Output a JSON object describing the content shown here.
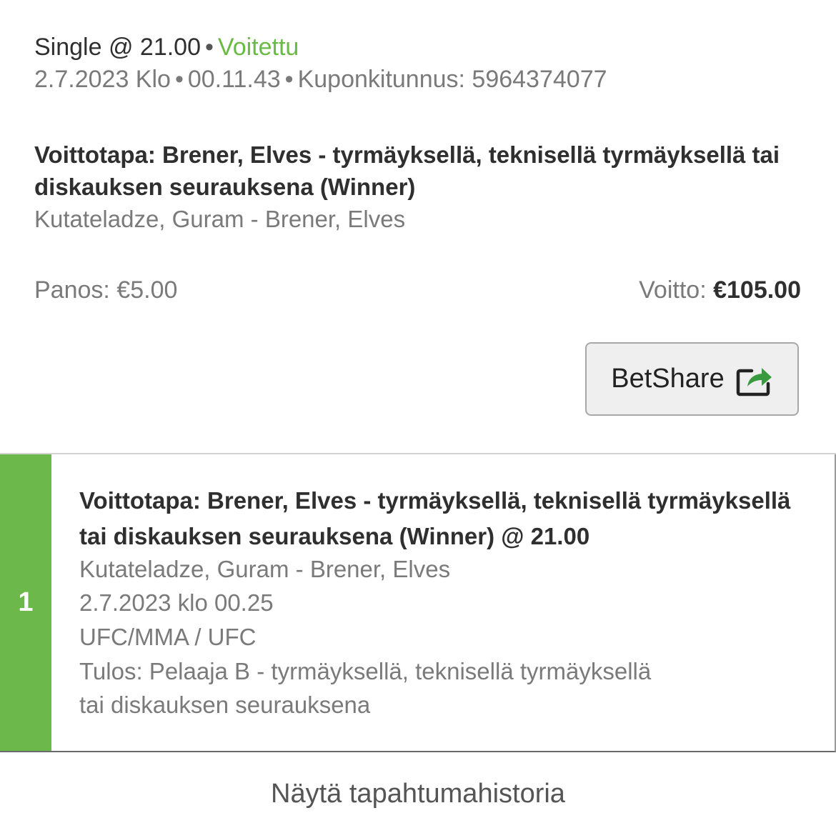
{
  "coupon": {
    "bet_type": "Single @ 21.00",
    "separator": "•",
    "status": "Voitettu",
    "date": "2.7.2023 Klo",
    "time": "00.11.43",
    "coupon_id_label": "Kuponkitunnus: 5964374077",
    "selection_title": "Voittotapa: Brener, Elves - tyrmäyksellä, teknisellä tyrmäyksellä tai diskauksen seurauksena (Winner)",
    "selection_event": "Kutateladze, Guram - Brener, Elves",
    "stake_label": "Panos: €5.00",
    "payout_label": "Voitto:",
    "payout_value": "€105.00",
    "betshare_label": "BetShare",
    "betshare_icon": "share-icon"
  },
  "selection_card": {
    "index": "1",
    "title": "Voittotapa: Brener, Elves - tyrmäyksellä, teknisellä tyrmäyksellä tai diskauksen seurauksena (Winner) @ 21.00",
    "event": "Kutateladze, Guram - Brener, Elves",
    "datetime": "2.7.2023 klo 00.25",
    "category": "UFC/MMA / UFC",
    "result_line1": "Tulos: Pelaaja B - tyrmäyksellä, teknisellä tyrmäyksellä",
    "result_line2": "tai diskauksen seurauksena"
  },
  "history_link": "Näytä tapahtumahistoria",
  "colors": {
    "won_green": "#6aba45",
    "index_bar_green": "#6cb84a",
    "share_arrow_green": "#3a9a3f"
  }
}
